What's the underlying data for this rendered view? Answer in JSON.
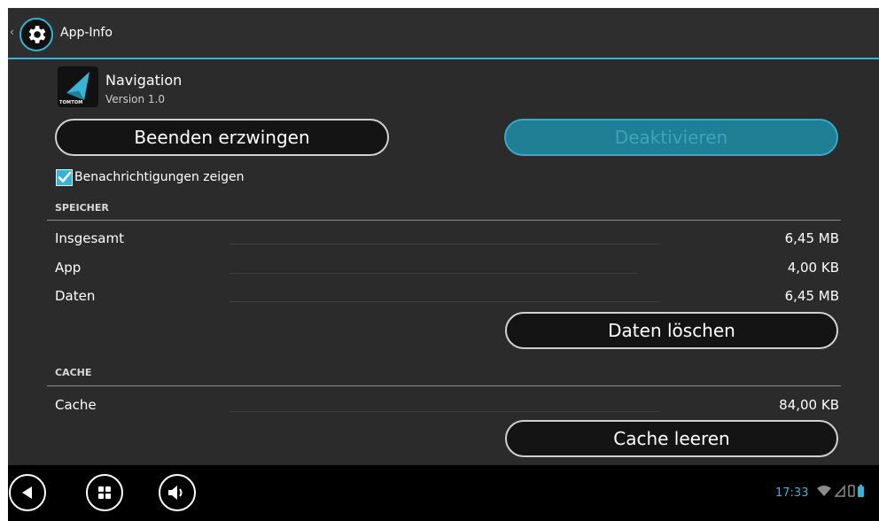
{
  "header": {
    "title": "App-Info",
    "up_glyph": "‹",
    "icon": "settings-gear-icon"
  },
  "app": {
    "name": "Navigation",
    "version": "Version 1.0",
    "icon_brand_text": "TOMTOM",
    "icon": "tomtom-navigation-icon"
  },
  "buttons": {
    "force_stop": "Beenden erzwingen",
    "disable": "Deaktivieren",
    "clear_data": "Daten löschen",
    "clear_cache": "Cache leeren"
  },
  "notifications": {
    "label": "Benachrichtigungen zeigen",
    "checked": true
  },
  "storage": {
    "header": "SPEICHER",
    "rows": [
      {
        "label": "Insgesamt",
        "value": "6,45 MB"
      },
      {
        "label": "App",
        "value": "4,00 KB"
      },
      {
        "label": "Daten",
        "value": "6,45 MB"
      }
    ]
  },
  "cache": {
    "header": "CACHE",
    "rows": [
      {
        "label": "Cache",
        "value": "84,00 KB"
      }
    ]
  },
  "navbar": {
    "back_icon": "back-arrow-icon",
    "home_icon": "home-grid-icon",
    "volume_icon": "volume-icon"
  },
  "statusbar": {
    "time": "17:33",
    "icons": [
      "wifi-icon",
      "signal-icon",
      "bluetooth-icon",
      "battery-icon"
    ]
  },
  "colors": {
    "accent": "#34b5d6",
    "background": "#2b2b2b",
    "button_bg": "#141414",
    "disabled_button_bg": "#1e7f95"
  }
}
